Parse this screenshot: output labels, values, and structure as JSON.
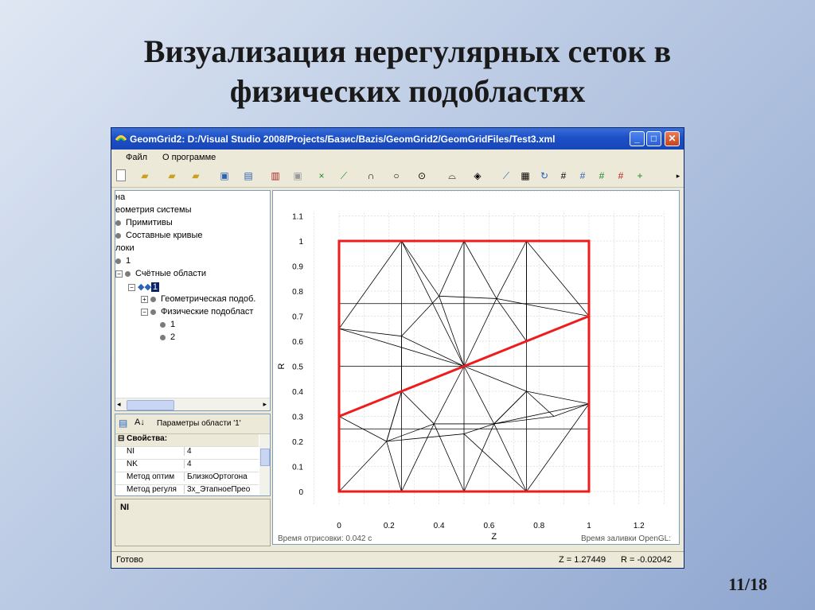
{
  "slide": {
    "title_line1": "Визуализация нерегулярных сеток в",
    "title_line2": "физических подобластях",
    "page": "11/18"
  },
  "window": {
    "title": "GeomGrid2: D:/Visual Studio 2008/Projects/Базис/Bazis/GeomGrid2/GeomGridFiles/Test3.xml",
    "minimize": "_",
    "maximize": "□",
    "close": "✕"
  },
  "menu": {
    "file": "Файл",
    "about": "О программе"
  },
  "tree": {
    "items": [
      "на",
      "еометрия системы",
      "Примитивы",
      "Составные кривые",
      "локи",
      "1",
      "Счётные области",
      "1",
      "Геометрическая подоб.",
      "Физические подобласт",
      "1",
      "2"
    ]
  },
  "props": {
    "header": "Параметры области '1'",
    "section": "Свойства:",
    "rows": [
      {
        "name": "NI",
        "value": "4"
      },
      {
        "name": "NK",
        "value": "4"
      },
      {
        "name": "Метод оптим",
        "value": "БлизкоОртогона"
      },
      {
        "name": "Метод регуля",
        "value": "3х_ЭтапноеПрео"
      }
    ],
    "description_title": "NI"
  },
  "plot": {
    "xlabel": "Z",
    "ylabel": "R",
    "x_ticks": [
      "0",
      "0.2",
      "0.4",
      "0.6",
      "0.8",
      "1",
      "1.2"
    ],
    "y_ticks": [
      "0",
      "0.1",
      "0.2",
      "0.3",
      "0.4",
      "0.5",
      "0.6",
      "0.7",
      "0.8",
      "0.9",
      "1",
      "1.1"
    ],
    "render_time": "Время отрисовки: 0.042 с",
    "fill_time": "Время заливки OpenGL:",
    "colors": {
      "boundary": "#ee1c1c",
      "mesh": "#000000",
      "grid": "#c8c8c8"
    }
  },
  "status": {
    "ready": "Готово",
    "z": "Z = 1.27449",
    "r": "R = -0.02042"
  }
}
